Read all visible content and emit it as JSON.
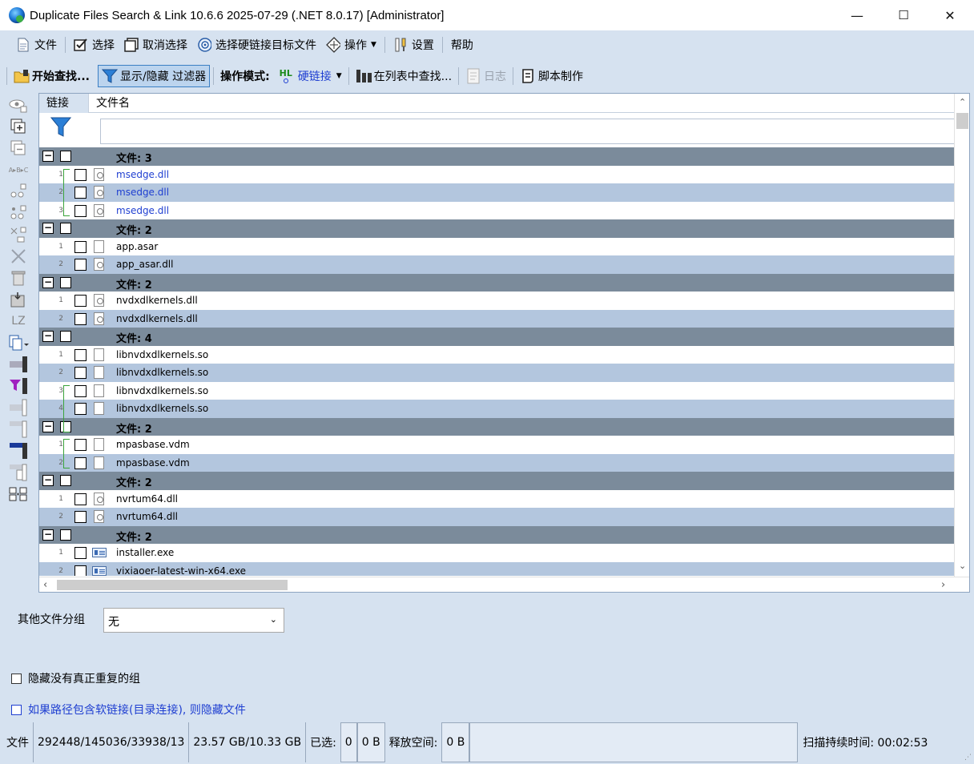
{
  "titlebar": {
    "title": "Duplicate Files Search & Link 10.6.6 2025-07-29 (.NET 8.0.17) [Administrator]",
    "minimize": "—",
    "maximize": "☐",
    "close": "✕"
  },
  "menu": {
    "file": "文件",
    "select": "选择",
    "deselect": "取消选择",
    "select_hardlink_target": "选择硬链接目标文件",
    "actions": "操作",
    "settings": "设置",
    "help": "帮助"
  },
  "toolbar": {
    "start_search": "开始查找...",
    "show_hide_filter": "显示/隐藏 过滤器",
    "mode_label": "操作模式:",
    "mode_icon_text": "HL",
    "mode_value": "硬链接",
    "find_in_list": "在列表中查找...",
    "log": "日志",
    "script": "脚本制作"
  },
  "leftbar": {
    "lz_label": "LZ"
  },
  "grid": {
    "col_link": "链接",
    "col_filename": "文件名",
    "groups": [
      {
        "label": "文件: 3",
        "files": [
          {
            "num": "1",
            "name": "msedge.dll",
            "type": "dll",
            "linked": true
          },
          {
            "num": "2",
            "name": "msedge.dll",
            "type": "dll",
            "linked": true
          },
          {
            "num": "3",
            "name": "msedge.dll",
            "type": "dll",
            "linked": true
          }
        ]
      },
      {
        "label": "文件: 2",
        "files": [
          {
            "num": "1",
            "name": "app.asar",
            "type": "file",
            "linked": false
          },
          {
            "num": "2",
            "name": "app_asar.dll",
            "type": "dll",
            "linked": false
          }
        ]
      },
      {
        "label": "文件: 2",
        "files": [
          {
            "num": "1",
            "name": "nvdxdlkernels.dll",
            "type": "dll",
            "linked": false
          },
          {
            "num": "2",
            "name": "nvdxdlkernels.dll",
            "type": "dll",
            "linked": false
          }
        ]
      },
      {
        "label": "文件: 4",
        "files": [
          {
            "num": "1",
            "name": "libnvdxdlkernels.so",
            "type": "file",
            "linked": false
          },
          {
            "num": "2",
            "name": "libnvdxdlkernels.so",
            "type": "file",
            "linked": false
          },
          {
            "num": "3",
            "name": "libnvdxdlkernels.so",
            "type": "file",
            "linked": false
          },
          {
            "num": "4",
            "name": "libnvdxdlkernels.so",
            "type": "file",
            "linked": false
          }
        ]
      },
      {
        "label": "文件: 2",
        "files": [
          {
            "num": "1",
            "name": "mpasbase.vdm",
            "type": "file",
            "linked": false
          },
          {
            "num": "2",
            "name": "mpasbase.vdm",
            "type": "file",
            "linked": false
          }
        ]
      },
      {
        "label": "文件: 2",
        "files": [
          {
            "num": "1",
            "name": "nvrtum64.dll",
            "type": "dll",
            "linked": false
          },
          {
            "num": "2",
            "name": "nvrtum64.dll",
            "type": "dll",
            "linked": false
          }
        ]
      },
      {
        "label": "文件: 2",
        "files": [
          {
            "num": "1",
            "name": "installer.exe",
            "type": "exe",
            "linked": false
          },
          {
            "num": "2",
            "name": "vixiaoer-latest-win-x64.exe",
            "type": "exe",
            "linked": false
          }
        ]
      }
    ]
  },
  "brackets": [
    [
      0,
      0,
      3
    ],
    [
      3,
      2,
      3
    ],
    [
      4,
      0,
      2
    ]
  ],
  "options": {
    "other_group_label": "其他文件分组",
    "other_group_value": "无",
    "hide_no_real_dup": "隐藏没有真正重复的组",
    "hide_symlink": "如果路径包含软链接(目录连接), 则隐藏文件"
  },
  "status": {
    "files_label": "文件",
    "counts": "292448/145036/33938/13",
    "sizes": "23.57 GB/10.33 GB",
    "selected_label": "已选:",
    "selected_count": "0",
    "selected_size": "0 B",
    "free_label": "释放空间:",
    "free_value": "0 B",
    "scan_duration": "扫描持续时间: 00:02:53"
  },
  "colors": {
    "group_row": "#7b8b9b",
    "alt_row": "#b3c6de",
    "link_text": "#1f3fd1",
    "bracket": "#3aa33a"
  }
}
